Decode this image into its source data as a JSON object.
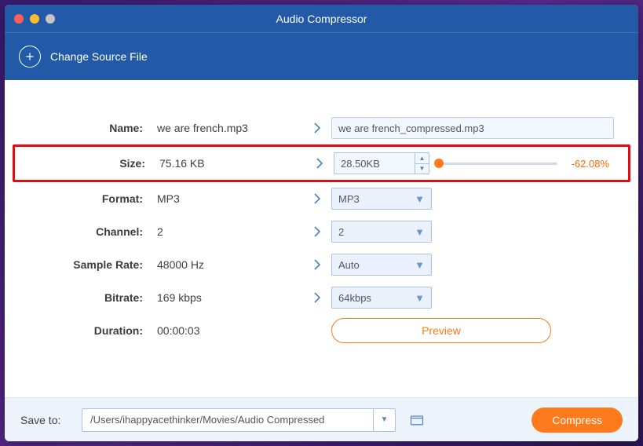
{
  "window": {
    "title": "Audio Compressor"
  },
  "subheader": {
    "change_source": "Change Source File"
  },
  "rows": {
    "name": {
      "label": "Name:",
      "src": "we are french.mp3",
      "out": "we are french_compressed.mp3"
    },
    "size": {
      "label": "Size:",
      "src": "75.16 KB",
      "out": "28.50KB",
      "delta": "-62.08%"
    },
    "format": {
      "label": "Format:",
      "src": "MP3",
      "out": "MP3"
    },
    "channel": {
      "label": "Channel:",
      "src": "2",
      "out": "2"
    },
    "samplerate": {
      "label": "Sample Rate:",
      "src": "48000 Hz",
      "out": "Auto"
    },
    "bitrate": {
      "label": "Bitrate:",
      "src": "169 kbps",
      "out": "64kbps"
    },
    "duration": {
      "label": "Duration:",
      "src": "00:00:03"
    }
  },
  "preview": {
    "label": "Preview"
  },
  "footer": {
    "save_to_label": "Save to:",
    "path": "/Users/ihappyacethinker/Movies/Audio Compressed",
    "compress_label": "Compress"
  }
}
